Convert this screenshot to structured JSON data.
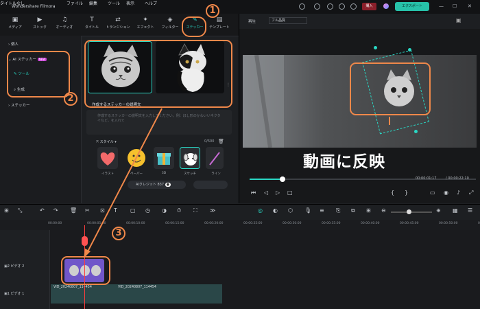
{
  "titlebar": {
    "app_name": "Wondershare Filmora",
    "menu": [
      "ファイル",
      "編集",
      "ツール",
      "表示",
      "ヘルプ"
    ],
    "project_title": "タイトルなし",
    "purchase_label": "購入",
    "export_label": "エクスポート"
  },
  "media_tabs": [
    {
      "label": "メディア",
      "icon": "▣"
    },
    {
      "label": "ストック",
      "icon": "▶"
    },
    {
      "label": "オーディオ",
      "icon": "♫"
    },
    {
      "label": "タイトル",
      "icon": "T"
    },
    {
      "label": "トランジション",
      "icon": "⇄"
    },
    {
      "label": "エフェクト",
      "icon": "✦"
    },
    {
      "label": "フィルター",
      "icon": "◈"
    },
    {
      "label": "ステッカー",
      "icon": "✎"
    },
    {
      "label": "テンプレート",
      "icon": "▤"
    }
  ],
  "sidebar": {
    "personal": "個人",
    "ai_sticker": "AI ステッカー",
    "ai_badge": "NEW",
    "tool": "ツール",
    "generate": "生成",
    "sticker": "ステッカー"
  },
  "prompt": {
    "label": "作成するステッカーの説明文",
    "placeholder": "作成するステッカーの説明文を入力してください。例：ほし形のかわいいネクタイなど。を入れて",
    "count": "0/500"
  },
  "styles": {
    "heading": "スタイル",
    "items": [
      "イラスト",
      "ペーパー",
      "3D",
      "スケッチ",
      "ライン"
    ]
  },
  "generate_btn": "AIクレジット 837",
  "preview": {
    "play_label": "再生",
    "quality": "フル品質",
    "current_time": "00:00:01:17",
    "total_time": "00:00:22:10"
  },
  "caption": "動画に反映",
  "ruler": [
    "00:00:00",
    "00:00:05:00",
    "00:00:10:00",
    "00:00:15:00",
    "00:00:20:00",
    "00:00:25:00",
    "00:00:30:00",
    "00:00:35:00",
    "00:00:40:00",
    "00:00:45:00",
    "00:00:50:00",
    "00:00:55:00"
  ],
  "tracks": [
    {
      "label": "ビデオ 2"
    },
    {
      "label": "ビデオ 1"
    }
  ],
  "clips": [
    "VID_20240807_114454",
    "VID_20240807_114454"
  ],
  "annotations": [
    "1",
    "2",
    "3"
  ],
  "colors": {
    "accent": "#29d8c5",
    "annotation": "#f0884a",
    "clip": "#7056c9"
  }
}
